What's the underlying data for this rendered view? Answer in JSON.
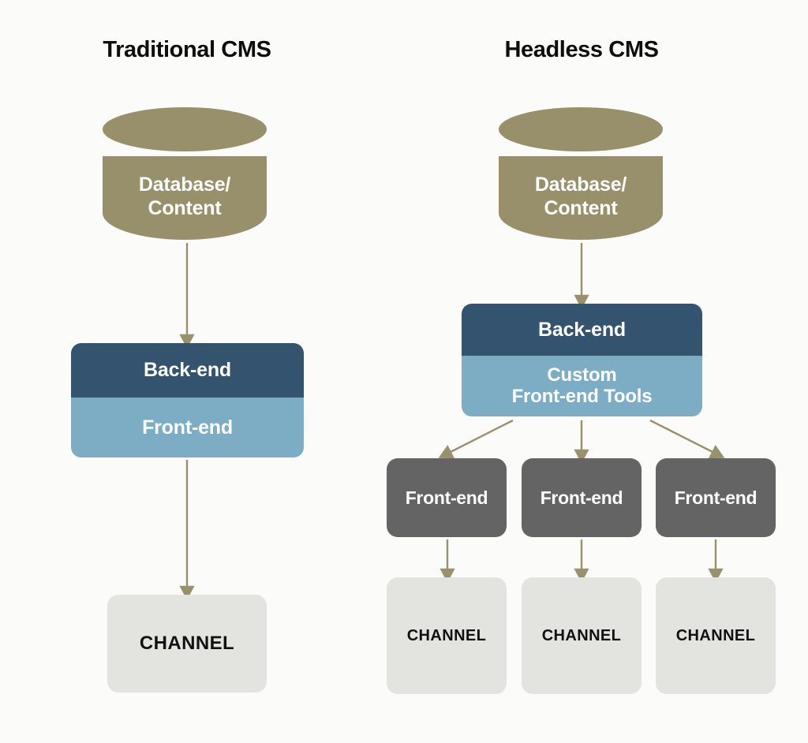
{
  "background_color": "#fbfbf9",
  "palette": {
    "khaki": "#98906a",
    "dark_blue": "#33536f",
    "light_blue": "#7cadc5",
    "dark_grey": "#646464",
    "light_grey": "#e3e3df",
    "arrow": "#99906d",
    "text_dark": "#0d0d0d",
    "text_light": "#ffffff"
  },
  "columns": {
    "traditional": {
      "title": "Traditional CMS",
      "database": {
        "line1": "Database/",
        "line2": "Content"
      },
      "stack": {
        "backend_label": "Back-end",
        "frontend_label": "Front-end"
      },
      "channel_label": "CHANNEL"
    },
    "headless": {
      "title": "Headless CMS",
      "database": {
        "line1": "Database/",
        "line2": "Content"
      },
      "stack": {
        "backend_label": "Back-end",
        "frontend_line1": "Custom",
        "frontend_line2": "Front-end Tools"
      },
      "frontends": [
        {
          "label": "Front-end"
        },
        {
          "label": "Front-end"
        },
        {
          "label": "Front-end"
        }
      ],
      "channels": [
        {
          "label": "CHANNEL"
        },
        {
          "label": "CHANNEL"
        },
        {
          "label": "CHANNEL"
        }
      ]
    }
  },
  "flow": {
    "traditional": [
      "Database/Content -> Back-end/Front-end",
      "Back-end/Front-end -> CHANNEL"
    ],
    "headless": [
      "Database/Content -> Back-end/Custom Front-end Tools",
      "Back-end/Custom Front-end Tools -> Front-end (1)",
      "Back-end/Custom Front-end Tools -> Front-end (2)",
      "Back-end/Custom Front-end Tools -> Front-end (3)",
      "Front-end (1) -> CHANNEL (1)",
      "Front-end (2) -> CHANNEL (2)",
      "Front-end (3) -> CHANNEL (3)"
    ]
  }
}
